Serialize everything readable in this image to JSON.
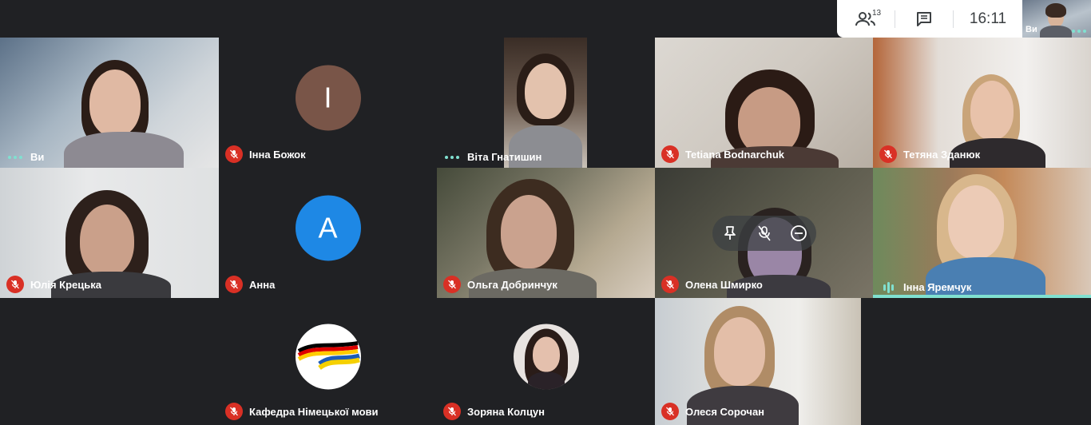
{
  "toolbar": {
    "people_count": "13",
    "time": "16:11"
  },
  "self_thumbnail": {
    "label": "Ви"
  },
  "participants": [
    {
      "name": "Ви"
    },
    {
      "name": "Інна Божок",
      "avatar_letter": "І"
    },
    {
      "name": "Віта Гнатишин"
    },
    {
      "name": "Tetiana Bodnarchuk"
    },
    {
      "name": "Тетяна Зданюк"
    },
    {
      "name": "Юлія Крецька"
    },
    {
      "name": "Анна",
      "avatar_letter": "А"
    },
    {
      "name": "Ольга Добринчук"
    },
    {
      "name": "Олена Шмирко"
    },
    {
      "name": "Інна Яремчук"
    },
    {
      "name": "Кафедра Німецької мови",
      "logo_text": "Кафедра німецької мови"
    },
    {
      "name": "Зоряна Колцун"
    },
    {
      "name": "Олеся Сорочан"
    }
  ],
  "colors": {
    "background": "#202124",
    "mic_off": "#d93025",
    "speaking": "#80e0d0",
    "avatar_brown": "#795548",
    "avatar_blue": "#1e88e5"
  }
}
